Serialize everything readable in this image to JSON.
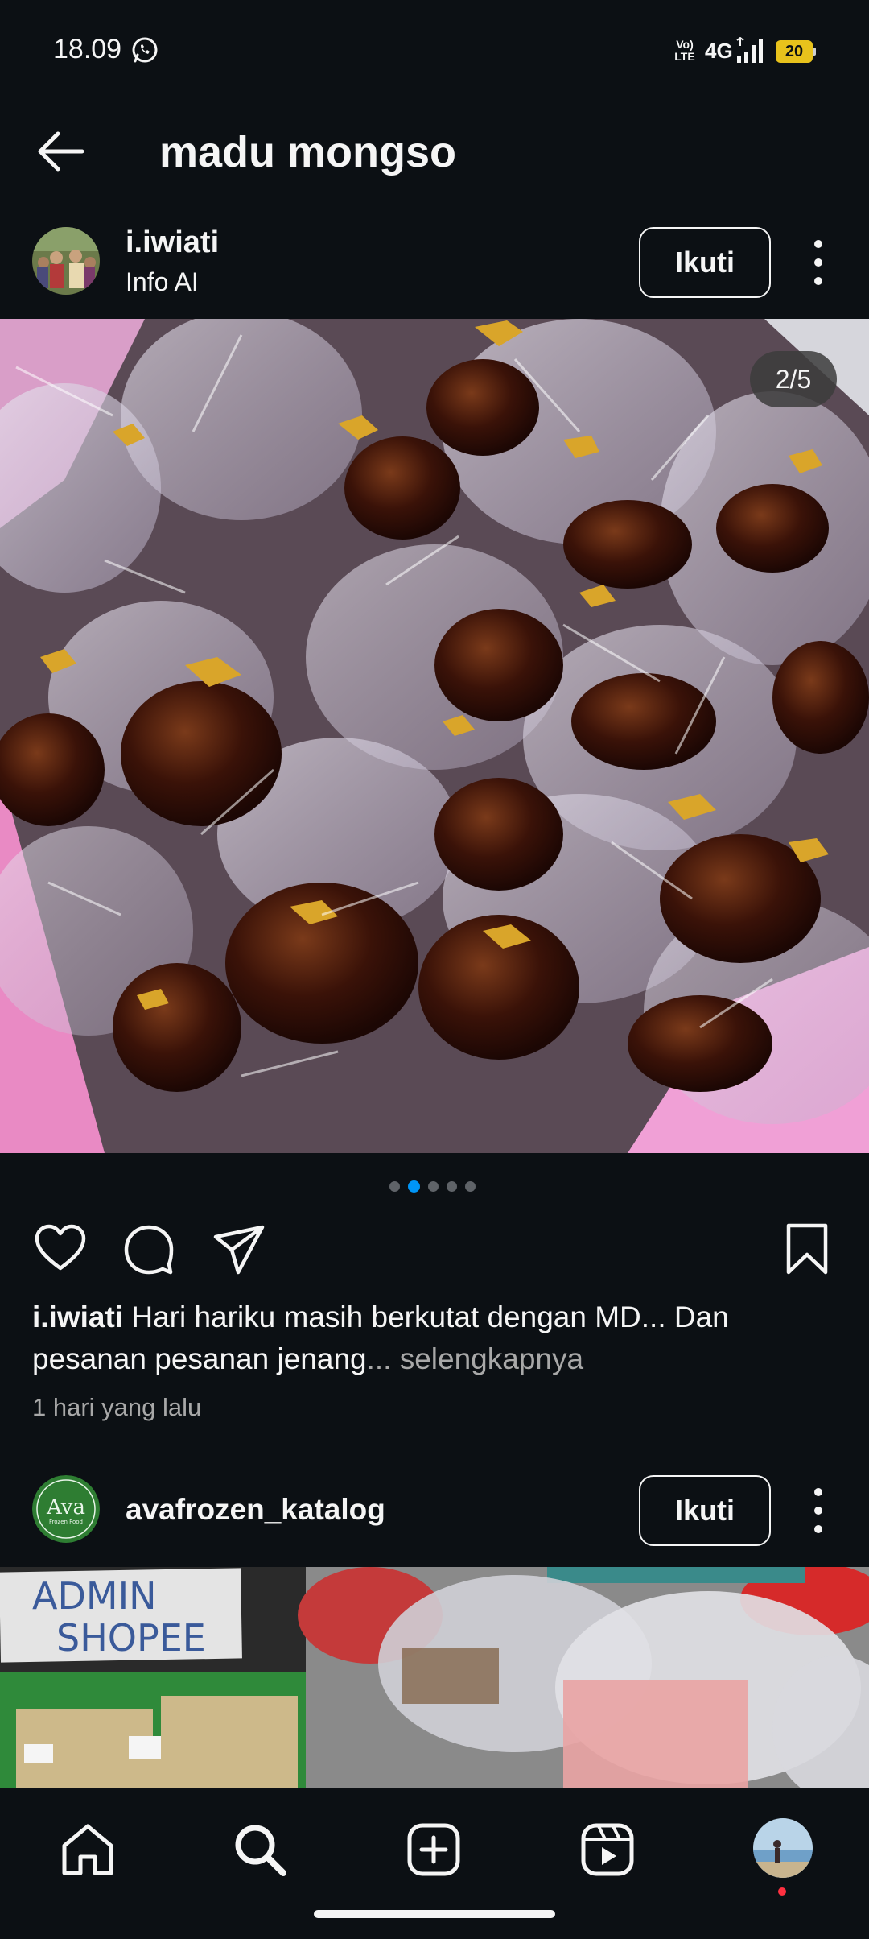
{
  "status_bar": {
    "time": "18.09",
    "volte_label": "Vo) LTE",
    "network": "4G",
    "battery_level": "20"
  },
  "header": {
    "title": "madu mongso",
    "back_icon": "arrow-left-icon"
  },
  "post1": {
    "username": "i.iwiati",
    "subtitle": "Info AI",
    "follow_label": "Ikuti",
    "page_indicator": "2/5",
    "carousel": {
      "total": 5,
      "active_index": 1
    },
    "caption_user": "i.iwiati",
    "caption_text": " Hari hariku masih berkutat dengan MD... Dan pesanan pesanan jenang",
    "caption_more": "... selengkapnya",
    "timestamp": "1 hari yang lalu"
  },
  "post2": {
    "username": "avafrozen_katalog",
    "follow_label": "Ikuti",
    "avatar_text": "Ava",
    "avatar_subtext": "Frozen Food",
    "photo_sign_line1": "ADMIN",
    "photo_sign_line2": "SHOPEE"
  },
  "bottom_nav": {
    "items": [
      "home-icon",
      "search-icon",
      "create-icon",
      "reels-icon",
      "profile-avatar"
    ],
    "active": "search-icon"
  },
  "colors": {
    "background": "#0c1014",
    "text": "#f5f5f5",
    "muted": "#a8a8a8",
    "accent": "#0095f6",
    "notification": "#ff3040",
    "battery": "#e8c21c"
  }
}
